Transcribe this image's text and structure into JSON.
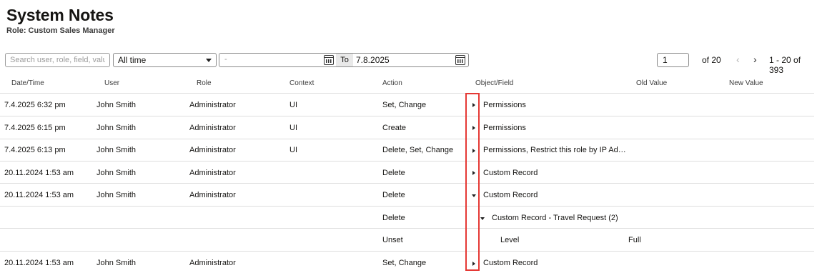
{
  "page": {
    "title": "System Notes",
    "subtitle": "Role: Custom Sales Manager"
  },
  "filters": {
    "search_placeholder": "Search user, role, field, value",
    "period": "All time",
    "date_from_placeholder": "-",
    "to_label": "To",
    "date_to": "7.8.2025"
  },
  "pagination": {
    "page": "1",
    "of_pages": "of 20",
    "range": "1 - 20 of 393"
  },
  "columns": [
    "Date/Time",
    "User",
    "Role",
    "Context",
    "Action",
    "Object/Field",
    "Old Value",
    "New Value"
  ],
  "rows": [
    {
      "datetime": "7.4.2025 6:32 pm",
      "user": "John Smith",
      "role": "Administrator",
      "context": "UI",
      "action": "Set, Change",
      "object": "Permissions"
    },
    {
      "datetime": "7.4.2025 6:15 pm",
      "user": "John Smith",
      "role": "Administrator",
      "context": "UI",
      "action": "Create",
      "object": "Permissions"
    },
    {
      "datetime": "7.4.2025 6:13 pm",
      "user": "John Smith",
      "role": "Administrator",
      "context": "UI",
      "action": "Delete, Set, Change",
      "object": "Permissions, Restrict this role by IP Ad…"
    },
    {
      "datetime": "20.11.2024 1:53 am",
      "user": "John Smith",
      "role": "Administrator",
      "context": "",
      "action": "Delete",
      "object": "Custom Record"
    },
    {
      "datetime": "20.11.2024 1:53 am",
      "user": "John Smith",
      "role": "Administrator",
      "context": "",
      "action": "Delete",
      "object": "Custom Record"
    },
    {
      "datetime": "",
      "user": "",
      "role": "",
      "context": "",
      "action": "Delete",
      "object": "Custom Record - Travel Request (2)"
    },
    {
      "datetime": "",
      "user": "",
      "role": "",
      "context": "",
      "action": "Unset",
      "object": "Level",
      "old_value": "Full"
    },
    {
      "datetime": "20.11.2024 1:53 am",
      "user": "John Smith",
      "role": "Administrator",
      "context": "",
      "action": "Set, Change",
      "object": "Custom Record"
    }
  ],
  "icons": {
    "calendar": "calendar-icon",
    "dropdown": "chevron-down-icon",
    "prev": "chevron-left-icon",
    "next": "chevron-right-icon",
    "expand": "caret-right-icon",
    "collapse": "caret-down-icon"
  },
  "colors": {
    "highlight_border": "#e53935",
    "row_divider": "#dfdfdf"
  }
}
